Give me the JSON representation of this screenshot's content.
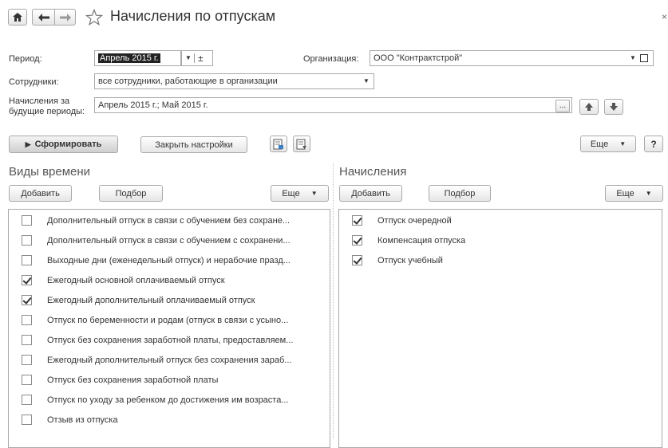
{
  "window": {
    "title": "Начисления по отпускам",
    "close_glyph": "×"
  },
  "nav": {
    "home_icon": "home-icon",
    "back_icon": "arrow-left-icon",
    "forward_icon": "arrow-right-icon",
    "star_icon": "star-icon"
  },
  "filters": {
    "period_label": "Период:",
    "period_value": "Апрель 2015 г.",
    "org_label": "Организация:",
    "org_value": "ООО \"Контрактстрой\"",
    "employees_label": "Сотрудники:",
    "employees_value": "все сотрудники, работающие в организации",
    "future_label_line1": "Начисления за",
    "future_label_line2": "будущие периоды:",
    "future_value": "Апрель 2015 г.; Май 2015 г.",
    "ellipsis": "..."
  },
  "toolbar": {
    "generate_label": "Сформировать",
    "close_settings_label": "Закрыть настройки",
    "more_label": "Еще",
    "help_label": "?"
  },
  "left_panel": {
    "title": "Виды времени",
    "add_label": "Добавить",
    "select_label": "Подбор",
    "more_label": "Еще",
    "items": [
      {
        "text": "Дополнительный отпуск в связи с обучением без сохране...",
        "checked": false
      },
      {
        "text": "Дополнительный отпуск в связи с обучением с сохранени...",
        "checked": false
      },
      {
        "text": "Выходные дни (еженедельный отпуск) и нерабочие празд...",
        "checked": false
      },
      {
        "text": "Ежегодный основной оплачиваемый отпуск",
        "checked": true
      },
      {
        "text": "Ежегодный дополнительный оплачиваемый отпуск",
        "checked": true
      },
      {
        "text": "Отпуск по беременности и родам (отпуск в связи с усыно...",
        "checked": false
      },
      {
        "text": "Отпуск без сохранения заработной платы, предоставляем...",
        "checked": false
      },
      {
        "text": "Ежегодный дополнительный отпуск без сохранения зараб...",
        "checked": false
      },
      {
        "text": "Отпуск без сохранения заработной платы",
        "checked": false
      },
      {
        "text": "Отпуск по уходу за ребенком до достижения им возраста...",
        "checked": false
      },
      {
        "text": "Отзыв из отпуска",
        "checked": false
      }
    ]
  },
  "right_panel": {
    "title": "Начисления",
    "add_label": "Добавить",
    "select_label": "Подбор",
    "more_label": "Еще",
    "items": [
      {
        "text": "Отпуск очередной",
        "checked": true
      },
      {
        "text": "Компенсация отпуска",
        "checked": true
      },
      {
        "text": "Отпуск учебный",
        "checked": true
      }
    ]
  }
}
